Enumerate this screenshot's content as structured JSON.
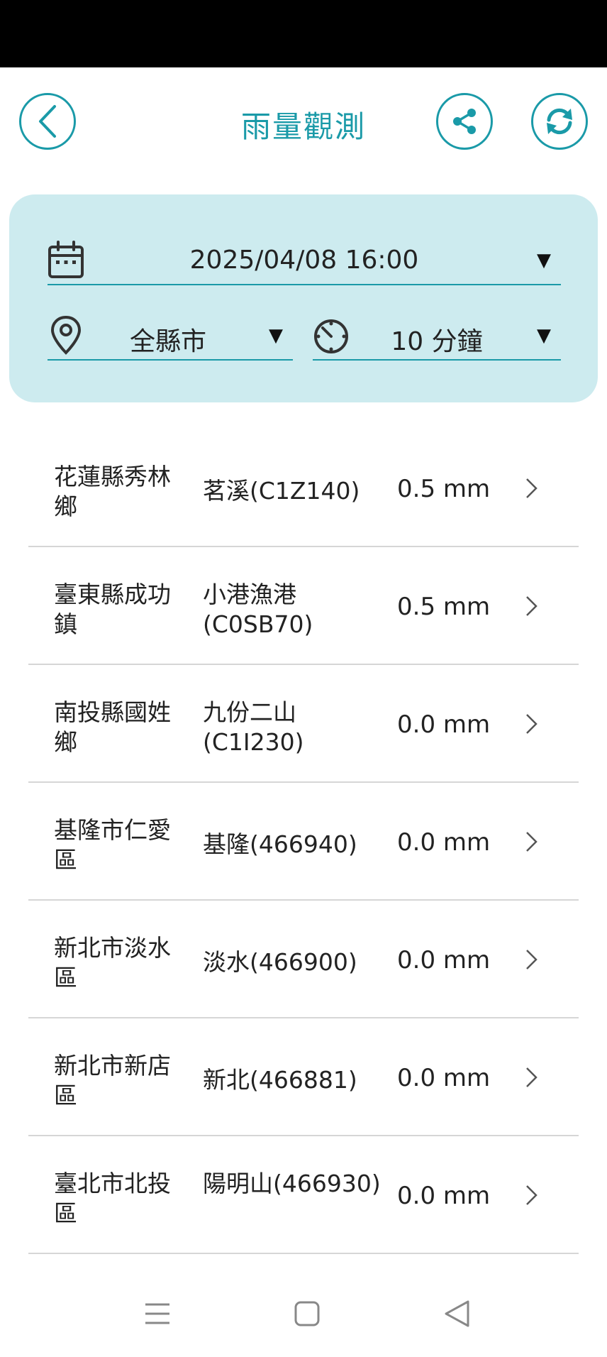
{
  "header": {
    "title": "雨量觀測",
    "back_icon": "chevron-left-icon",
    "share_icon": "share-icon",
    "refresh_icon": "refresh-icon",
    "accent_color": "#1a9aa8"
  },
  "filters": {
    "datetime": "2025/04/08 16:00",
    "county": "全縣市",
    "interval": "10 分鐘",
    "caret": "▼",
    "panel_color": "#cdebef"
  },
  "stations": [
    {
      "area": "花蓮縣秀林鄉",
      "station": "茗溪(C1Z140)",
      "rain": "0.5 mm"
    },
    {
      "area": "臺東縣成功鎮",
      "station": "小港漁港(C0SB70)",
      "rain": "0.5 mm"
    },
    {
      "area": "南投縣國姓鄉",
      "station": "九份二山(C1I230)",
      "rain": "0.0 mm"
    },
    {
      "area": "基隆市仁愛區",
      "station": "基隆(466940)",
      "rain": "0.0 mm"
    },
    {
      "area": "新北市淡水區",
      "station": "淡水(466900)",
      "rain": "0.0 mm"
    },
    {
      "area": "新北市新店區",
      "station": "新北(466881)",
      "rain": "0.0 mm"
    },
    {
      "area": "臺北市北投區",
      "station": "陽明山(466930)",
      "rain": "0.0 mm"
    }
  ]
}
